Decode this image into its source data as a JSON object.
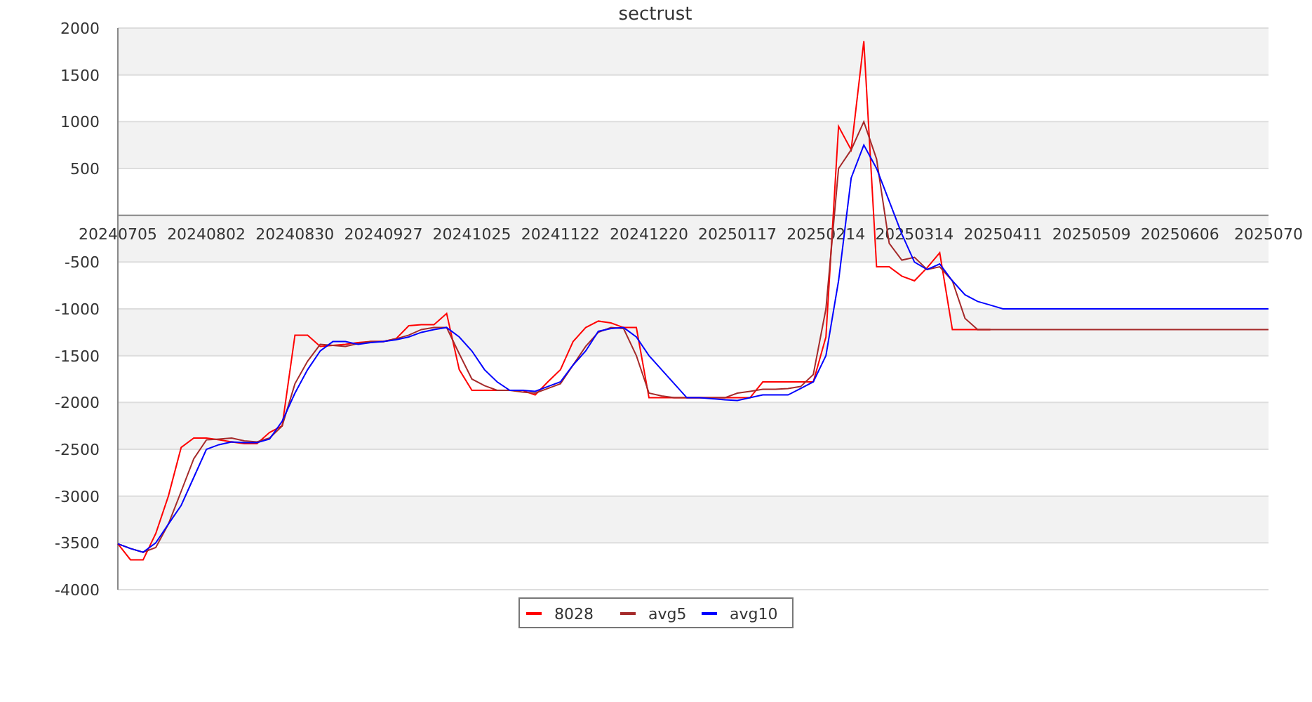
{
  "chart_data": {
    "type": "line",
    "title": "sectrust",
    "categories": [
      "20240705",
      null,
      null,
      null,
      null,
      null,
      null,
      "20240802",
      null,
      null,
      null,
      null,
      null,
      null,
      "20240830",
      null,
      null,
      null,
      null,
      null,
      null,
      "20240927",
      null,
      null,
      null,
      null,
      null,
      null,
      "20241025",
      null,
      null,
      null,
      null,
      null,
      null,
      "20241122",
      null,
      null,
      null,
      null,
      null,
      null,
      "20241220",
      null,
      null,
      null,
      null,
      null,
      null,
      "20250117",
      null,
      null,
      null,
      null,
      null,
      null,
      "20250214",
      null,
      null,
      null,
      null,
      null,
      null,
      "20250314",
      null,
      null,
      null,
      null,
      null,
      null,
      "20250411",
      null,
      null,
      null,
      null,
      null,
      null,
      "20250509",
      null,
      null,
      null,
      null,
      null,
      null,
      "20250606",
      null,
      null,
      null,
      null,
      null,
      null,
      "2025070"
    ],
    "series": [
      {
        "name": "8028",
        "color": "#ff0000",
        "values": [
          -3510,
          -3680,
          -3680,
          -3400,
          -3000,
          -2480,
          -2380,
          -2380,
          -2400,
          -2420,
          -2440,
          -2440,
          -2320,
          -2250,
          -1280,
          -1280,
          -1400,
          -1390,
          -1380,
          -1360,
          -1350,
          -1350,
          -1320,
          -1180,
          -1170,
          -1170,
          -1050,
          -1650,
          -1870,
          -1870,
          -1870,
          -1870,
          -1870,
          -1920,
          -1780,
          -1650,
          -1350,
          -1200,
          -1130,
          -1150,
          -1200,
          -1200,
          -1950,
          -1950,
          -1950,
          -1950,
          -1950,
          -1950,
          -1950,
          -1950,
          -1950,
          -1780,
          -1780,
          -1780,
          -1780,
          -1780,
          -1300,
          950,
          700,
          1860,
          -550,
          -550,
          -650,
          -700,
          -560,
          -400,
          -1220,
          -1220,
          -1220,
          -1220,
          null,
          null,
          null,
          null,
          null,
          null,
          null,
          null,
          null,
          null,
          null,
          null,
          null,
          null,
          null,
          null,
          null,
          null,
          null,
          null,
          null,
          null
        ]
      },
      {
        "name": "avg5",
        "color": "#a52a2a",
        "values": [
          -3510,
          -3560,
          -3600,
          -3550,
          -3300,
          -2950,
          -2600,
          -2400,
          -2390,
          -2380,
          -2410,
          -2420,
          -2380,
          -2250,
          -1800,
          -1560,
          -1380,
          -1390,
          -1400,
          -1370,
          -1350,
          -1350,
          -1320,
          -1280,
          -1220,
          -1200,
          -1200,
          -1480,
          -1750,
          -1820,
          -1870,
          -1870,
          -1890,
          -1900,
          -1850,
          -1800,
          -1600,
          -1400,
          -1250,
          -1200,
          -1210,
          -1500,
          -1900,
          -1930,
          -1950,
          -1950,
          -1950,
          -1950,
          -1950,
          -1900,
          -1880,
          -1860,
          -1860,
          -1850,
          -1830,
          -1700,
          -1000,
          500,
          700,
          1000,
          600,
          -300,
          -480,
          -450,
          -580,
          -550,
          -700,
          -1100,
          -1220,
          -1220,
          -1220,
          -1220,
          -1220,
          -1220,
          -1220,
          -1220,
          -1220,
          -1220,
          -1220,
          -1220,
          -1220,
          -1220,
          -1220,
          -1220,
          -1220,
          -1220,
          -1220,
          -1220,
          -1220,
          -1220,
          -1220,
          -1220
        ]
      },
      {
        "name": "avg10",
        "color": "#0000ff",
        "values": [
          -3510,
          -3560,
          -3600,
          -3500,
          -3300,
          -3100,
          -2800,
          -2500,
          -2450,
          -2420,
          -2430,
          -2430,
          -2390,
          -2200,
          -1900,
          -1650,
          -1450,
          -1350,
          -1350,
          -1380,
          -1360,
          -1350,
          -1330,
          -1300,
          -1250,
          -1220,
          -1200,
          -1300,
          -1450,
          -1650,
          -1780,
          -1870,
          -1870,
          -1880,
          -1830,
          -1780,
          -1600,
          -1450,
          -1240,
          -1210,
          -1200,
          -1300,
          -1500,
          -1650,
          -1800,
          -1950,
          -1950,
          -1960,
          -1970,
          -1980,
          -1950,
          -1920,
          -1920,
          -1920,
          -1850,
          -1780,
          -1500,
          -700,
          400,
          750,
          500,
          150,
          -200,
          -500,
          -580,
          -520,
          -700,
          -850,
          -920,
          -960,
          -1000,
          -1000,
          -1000,
          -1000,
          -1000,
          -1000,
          -1000,
          -1000,
          -1000,
          -1000,
          -1000,
          -1000,
          -1000,
          -1000,
          -1000,
          -1000,
          -1000,
          -1000,
          -1000,
          -1000,
          -1000,
          -1000
        ]
      }
    ],
    "grid": true,
    "legend": true,
    "ylim": [
      -4000,
      2000
    ],
    "yticks": [
      -4000,
      -3500,
      -3000,
      -2500,
      -2000,
      -1500,
      -1000,
      -500,
      500,
      1000,
      1500,
      2000
    ]
  }
}
